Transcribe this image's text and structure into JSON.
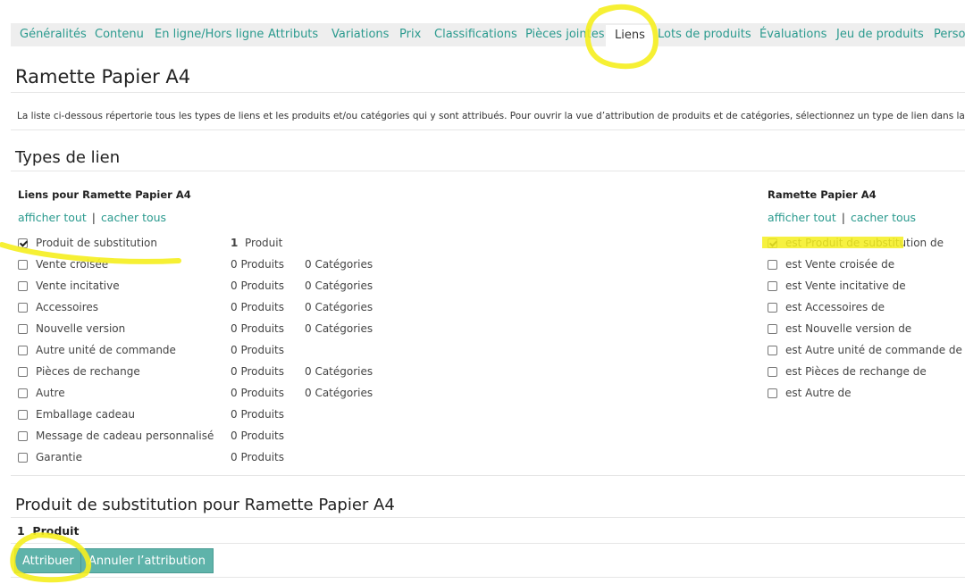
{
  "tabs": [
    {
      "label": "Généralités"
    },
    {
      "label": "Contenu"
    },
    {
      "label": "En ligne/Hors ligne"
    },
    {
      "label": "Attributs"
    },
    {
      "label": "Variations"
    },
    {
      "label": "Prix"
    },
    {
      "label": "Classifications"
    },
    {
      "label": "Pièces jointes"
    },
    {
      "label": "Liens",
      "active": true
    },
    {
      "label": "Lots de produits"
    },
    {
      "label": "Évaluations"
    },
    {
      "label": "Jeu de produits"
    },
    {
      "label": "Person"
    }
  ],
  "page_title": "Ramette Papier A4",
  "description": "La liste ci-dessous répertorie tous les types de liens et les produits et/ou catégories qui y sont attribués. Pour ouvrir la vue d’attribution de produits et de catégories, sélectionnez un type de lien dans la liste.",
  "types_section_title": "Types de lien",
  "left_column": {
    "heading": "Liens pour Ramette Papier A4",
    "show_all": "afficher tout",
    "separator": "|",
    "hide_all": "cacher tous",
    "rows": [
      {
        "label": "Produit de substitution",
        "checked": true,
        "count": "1",
        "products": "Produit",
        "categories": ""
      },
      {
        "label": "Vente croisée",
        "checked": false,
        "count": "",
        "products": "0 Produits",
        "categories": "0 Catégories"
      },
      {
        "label": "Vente incitative",
        "checked": false,
        "count": "",
        "products": "0 Produits",
        "categories": "0 Catégories"
      },
      {
        "label": "Accessoires",
        "checked": false,
        "count": "",
        "products": "0 Produits",
        "categories": "0 Catégories"
      },
      {
        "label": "Nouvelle version",
        "checked": false,
        "count": "",
        "products": "0 Produits",
        "categories": "0 Catégories"
      },
      {
        "label": "Autre unité de commande",
        "checked": false,
        "count": "",
        "products": "0 Produits",
        "categories": ""
      },
      {
        "label": "Pièces de rechange",
        "checked": false,
        "count": "",
        "products": "0 Produits",
        "categories": "0 Catégories"
      },
      {
        "label": "Autre",
        "checked": false,
        "count": "",
        "products": "0 Produits",
        "categories": "0 Catégories"
      },
      {
        "label": "Emballage cadeau",
        "checked": false,
        "count": "",
        "products": "0 Produits",
        "categories": ""
      },
      {
        "label": "Message de cadeau personnalisé",
        "checked": false,
        "count": "",
        "products": "0 Produits",
        "categories": ""
      },
      {
        "label": "Garantie",
        "checked": false,
        "count": "",
        "products": "0 Produits",
        "categories": ""
      }
    ]
  },
  "right_column": {
    "heading": "Ramette Papier A4",
    "show_all": "afficher tout",
    "separator": "|",
    "hide_all": "cacher tous",
    "rows": [
      {
        "label": "est Produit de substitution de",
        "checked": true
      },
      {
        "label": "est Vente croisée de",
        "checked": false
      },
      {
        "label": "est Vente incitative de",
        "checked": false
      },
      {
        "label": "est Accessoires de",
        "checked": false
      },
      {
        "label": "est Nouvelle version de",
        "checked": false
      },
      {
        "label": "est Autre unité de commande de",
        "checked": false
      },
      {
        "label": "est Pièces de rechange de",
        "checked": false
      },
      {
        "label": "est Autre de",
        "checked": false
      }
    ]
  },
  "substitution_section_title": "Produit de substitution pour Ramette Papier A4",
  "summary": {
    "count": "1",
    "label": "Produit"
  },
  "buttons": {
    "assign": "Attribuer",
    "unassign": "Annuler l’attribution"
  },
  "highlight_color": "#f5ee1e",
  "accent_color": "#2a9a8e",
  "button_color": "#5fb3aa"
}
